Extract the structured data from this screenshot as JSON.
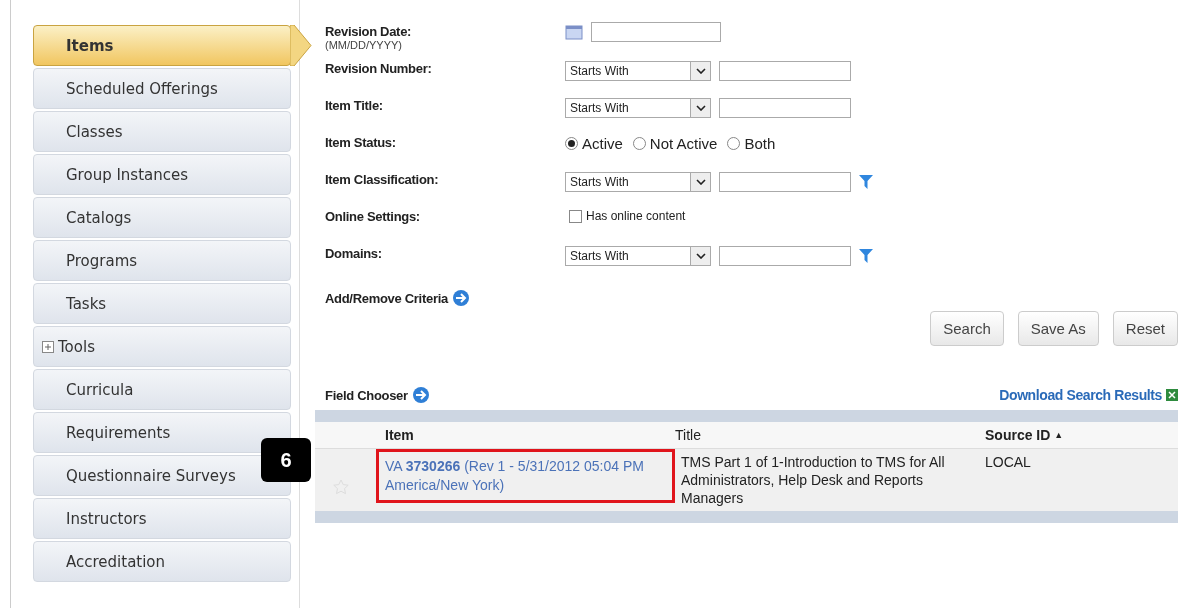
{
  "sidebar": {
    "items": [
      {
        "label": "Items",
        "selected": true,
        "kind": "link"
      },
      {
        "label": "Scheduled Offerings",
        "selected": false,
        "kind": "link"
      },
      {
        "label": "Classes",
        "selected": false,
        "kind": "link"
      },
      {
        "label": "Group Instances",
        "selected": false,
        "kind": "link"
      },
      {
        "label": "Catalogs",
        "selected": false,
        "kind": "link"
      },
      {
        "label": "Programs",
        "selected": false,
        "kind": "link"
      },
      {
        "label": "Tasks",
        "selected": false,
        "kind": "link"
      },
      {
        "label": "Tools",
        "selected": false,
        "kind": "expandable"
      },
      {
        "label": "Curricula",
        "selected": false,
        "kind": "link"
      },
      {
        "label": "Requirements",
        "selected": false,
        "kind": "link"
      },
      {
        "label": "Questionnaire Surveys",
        "selected": false,
        "kind": "link"
      },
      {
        "label": "Instructors",
        "selected": false,
        "kind": "link"
      },
      {
        "label": "Accreditation",
        "selected": false,
        "kind": "link"
      }
    ]
  },
  "form": {
    "fields": [
      {
        "kind": "date",
        "label": "Revision Date:",
        "hint": "(MM/DD/YYYY)"
      },
      {
        "kind": "text_filter",
        "label": "Revision Number:",
        "operator": "Starts With",
        "lookup": false
      },
      {
        "kind": "text_filter",
        "label": "Item Title:",
        "operator": "Starts With",
        "lookup": false
      },
      {
        "kind": "radio",
        "label": "Item Status:",
        "options": [
          {
            "label": "Active",
            "selected": true
          },
          {
            "label": "Not Active",
            "selected": false
          },
          {
            "label": "Both",
            "selected": false
          }
        ]
      },
      {
        "kind": "text_filter",
        "label": "Item Classification:",
        "operator": "Starts With",
        "lookup": true
      },
      {
        "kind": "checkbox",
        "label": "Online Settings:",
        "option": "Has online content",
        "checked": false
      },
      {
        "kind": "text_filter",
        "label": "Domains:",
        "operator": "Starts With",
        "lookup": true
      }
    ],
    "criteria_link": "Add/Remove Criteria",
    "buttons": [
      "Search",
      "Save As",
      "Reset"
    ]
  },
  "results": {
    "field_chooser": "Field Chooser",
    "download": "Download Search Results",
    "columns": [
      {
        "label": "Item"
      },
      {
        "label": "Title"
      },
      {
        "label": "Source ID",
        "sort_mark": "▲"
      }
    ],
    "rows": [
      {
        "item": "VA **3730266** (Rev 1 - 5/31/2012 05:04 PM America/New York)",
        "title": "TMS Part 1 of 1-Introduction to TMS for All Administrators, Help Desk and Reports Managers",
        "source_id": "LOCAL",
        "highlighted": true,
        "callout": "6"
      }
    ]
  }
}
